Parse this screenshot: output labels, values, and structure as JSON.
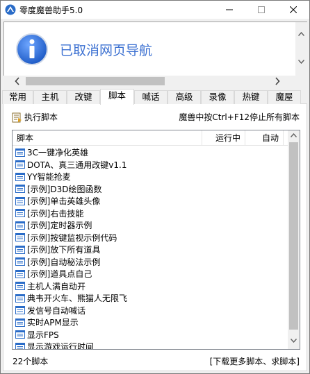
{
  "window": {
    "title": "零度魔兽助手5.0"
  },
  "banner": {
    "message": "已取消网页导航"
  },
  "tabs": [
    {
      "label": "常用"
    },
    {
      "label": "主机"
    },
    {
      "label": "改键"
    },
    {
      "label": "脚本"
    },
    {
      "label": "喊话"
    },
    {
      "label": "高级"
    },
    {
      "label": "录像"
    },
    {
      "label": "热键"
    },
    {
      "label": "魔屋"
    }
  ],
  "active_tab": "脚本",
  "toolbar": {
    "run_label": "执行脚本",
    "hotkey_hint": "魔兽中按Ctrl+F12停止所有脚本"
  },
  "list": {
    "columns": [
      "脚本",
      "运行中",
      "自动"
    ],
    "rows": [
      "3C一键净化英雄",
      "DOTA、真三通用改键v1.1",
      "YY智能抢麦",
      "[示例]D3D绘图函数",
      "[示例]单击英雄头像",
      "[示例]右击技能",
      "[示例]定时器示例",
      "[示例]按键监视示例代码",
      "[示例]放下所有道具",
      "[示例]自动秘法示例",
      "[示例]道具点自己",
      "主机人满自动开",
      "典韦开火车、熊猫人无限飞",
      "发信号自动喊话",
      "实时APM显示",
      "显示FPS",
      "显示游戏运行时间"
    ]
  },
  "status": {
    "count": "22个脚本",
    "download": "[下载更多脚本、求脚本]"
  },
  "colors": {
    "banner_text": "#3a6fd1",
    "info_icon": "#1e5bc6"
  }
}
